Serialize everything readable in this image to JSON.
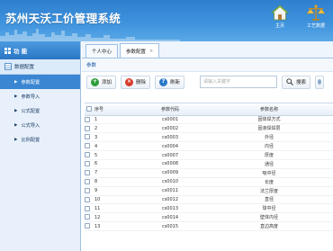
{
  "app_title": "苏州天沃工价管理系统",
  "header_buttons": [
    {
      "label": "主页",
      "icon": "home-icon"
    },
    {
      "label": "工艺数据",
      "icon": "scale-icon"
    }
  ],
  "sidebar": {
    "title": "功 能",
    "group_label": "数据配置",
    "items": [
      {
        "label": "参数配置",
        "active": true
      },
      {
        "label": "参数导入",
        "active": false
      },
      {
        "label": "公式配置",
        "active": false
      },
      {
        "label": "公式导入",
        "active": false
      },
      {
        "label": "比例配置",
        "active": false
      }
    ]
  },
  "tabs": [
    {
      "label": "个人中心",
      "closable": false
    },
    {
      "label": "参数配置",
      "closable": true
    }
  ],
  "panel_title": "参数",
  "toolbar": {
    "add_label": "添加",
    "delete_label": "删除",
    "refresh_label": "刷新",
    "search_placeholder": "请输入关键字",
    "search_label": "搜索"
  },
  "table": {
    "headers": {
      "no": "序号",
      "code": "参数代码",
      "name": "参数名称"
    },
    "rows": [
      {
        "no": "1",
        "code": "cs0001",
        "name": "固体焊方式"
      },
      {
        "no": "2",
        "code": "cs0002",
        "name": "固液焊焊层"
      },
      {
        "no": "3",
        "code": "cs0003",
        "name": "外径"
      },
      {
        "no": "4",
        "code": "cs0004",
        "name": "内径"
      },
      {
        "no": "5",
        "code": "cs0007",
        "name": "厚度"
      },
      {
        "no": "6",
        "code": "cs0008",
        "name": "通径"
      },
      {
        "no": "7",
        "code": "cs0009",
        "name": "吸中径"
      },
      {
        "no": "8",
        "code": "cs0010",
        "name": "长度"
      },
      {
        "no": "9",
        "code": "cs0011",
        "name": "法兰厚度"
      },
      {
        "no": "10",
        "code": "cs0012",
        "name": "直径"
      },
      {
        "no": "11",
        "code": "cs0013",
        "name": "球中径"
      },
      {
        "no": "12",
        "code": "cs0014",
        "name": "壁体内径"
      },
      {
        "no": "13",
        "code": "cs0015",
        "name": "直边高度"
      }
    ]
  },
  "colors": {
    "header_blue": "#3e93dd",
    "active_item": "#3a86d2",
    "add": "#2e9e3c",
    "delete": "#d83a2b",
    "refresh": "#2a78c8"
  }
}
